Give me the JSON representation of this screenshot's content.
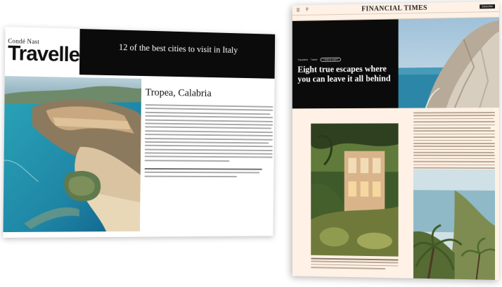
{
  "cnt": {
    "logo_small": "Condé Nast",
    "logo_big": "Traveller",
    "hero_title": "12 of the best cities to visit in Italy",
    "article_heading": "Tropea, Calabria",
    "colors": {
      "hero_bg": "#0b0b0b"
    },
    "icons": [
      "aerial-coast-photo"
    ]
  },
  "ft": {
    "masthead": "FINANCIAL TIMES",
    "menu_icon": "menu-icon",
    "search_icon": "search-icon",
    "subscribe": "Subscribe",
    "tag1": "Travellers",
    "tag2": "Travel",
    "tag3": "+ Add to myFT",
    "title": "Eight true escapes where you can leave it all behind",
    "colors": {
      "paper": "#fff1e5",
      "hero_bg": "#0b0b0b"
    }
  }
}
